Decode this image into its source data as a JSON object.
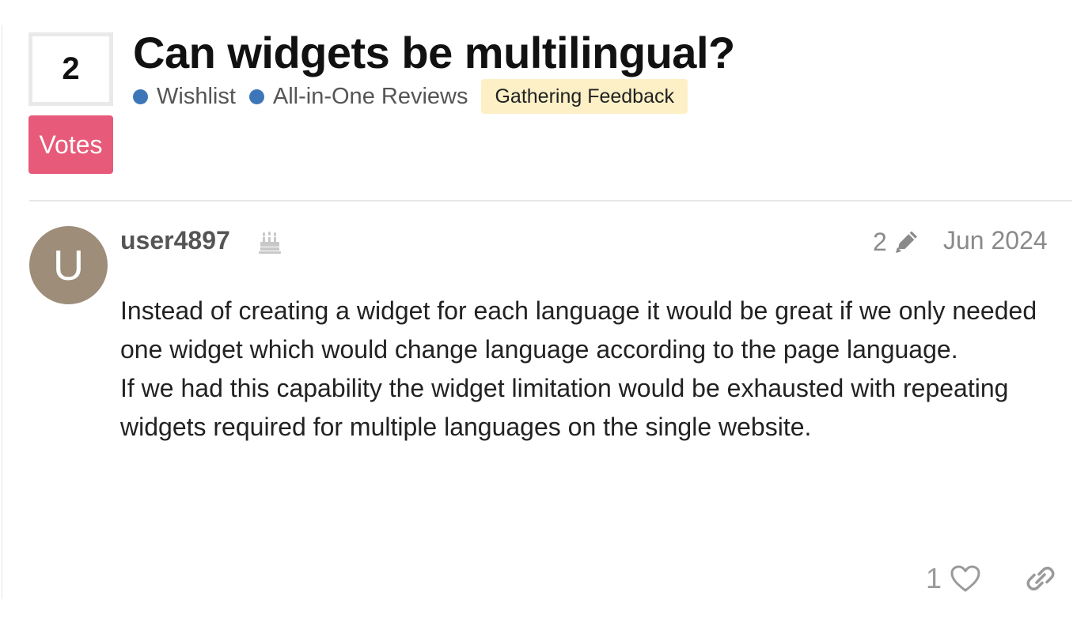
{
  "topic": {
    "vote_count": "2",
    "votes_label": "Votes",
    "title": "Can widgets be multilingual?",
    "categories": [
      {
        "label": "Wishlist",
        "color": "#3d76b8"
      },
      {
        "label": "All-in-One Reviews",
        "color": "#3d76b8"
      }
    ],
    "status": "Gathering Feedback",
    "status_color": "#fdf0c6",
    "votes_button_color": "#e85a79"
  },
  "post": {
    "avatar_letter": "U",
    "avatar_color": "#9d8d79",
    "username": "user4897",
    "badge_icon": "cake-icon",
    "edit_count": "2",
    "edit_icon": "pencil-icon",
    "date": "Jun 2024",
    "body": [
      "Instead of creating a widget for each language it would be great if we only needed one widget which would change language according to the page language.",
      "If we had this capability the widget limitation would be exhausted with repeating widgets required for multiple languages on the single website."
    ],
    "like_count": "1",
    "like_icon": "heart-icon",
    "share_icon": "link-icon"
  }
}
